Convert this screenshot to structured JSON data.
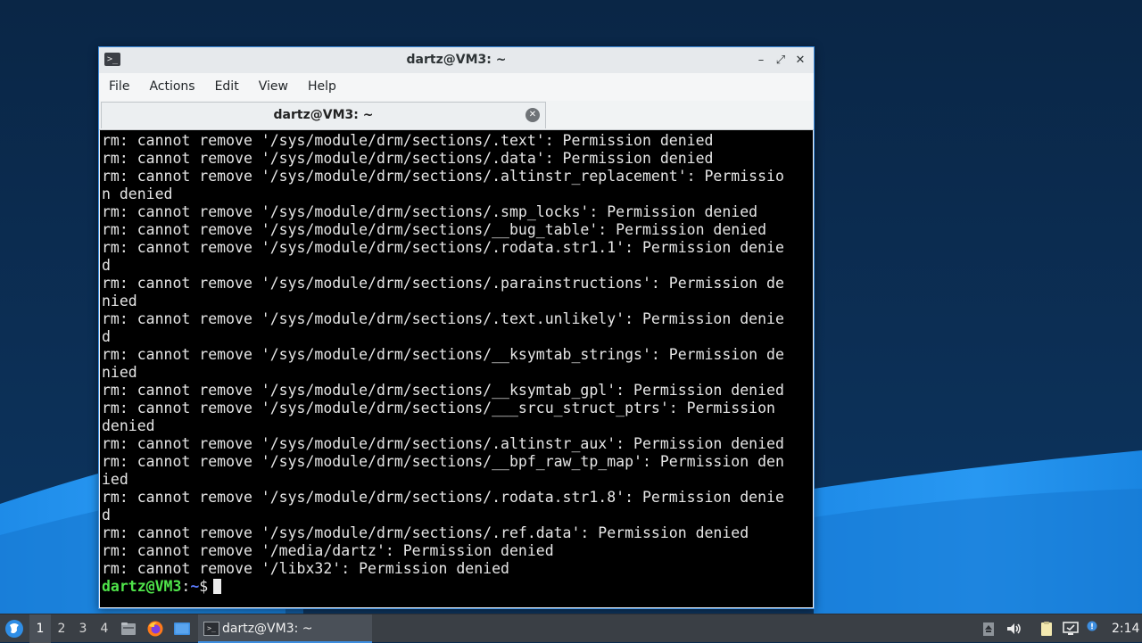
{
  "window": {
    "title": "dartz@VM3: ~",
    "app_icon": ">_",
    "controls": {
      "minimize": "–",
      "maximize": "⤢",
      "close": "✕"
    }
  },
  "menubar": {
    "items": [
      "File",
      "Actions",
      "Edit",
      "View",
      "Help"
    ]
  },
  "tab": {
    "label": "dartz@VM3: ~",
    "close_icon": "✕"
  },
  "terminal": {
    "lines": [
      "rm: cannot remove '/sys/module/drm/sections/.text': Permission denied",
      "rm: cannot remove '/sys/module/drm/sections/.data': Permission denied",
      "rm: cannot remove '/sys/module/drm/sections/.altinstr_replacement': Permissio",
      "n denied",
      "rm: cannot remove '/sys/module/drm/sections/.smp_locks': Permission denied",
      "rm: cannot remove '/sys/module/drm/sections/__bug_table': Permission denied",
      "rm: cannot remove '/sys/module/drm/sections/.rodata.str1.1': Permission denie",
      "d",
      "rm: cannot remove '/sys/module/drm/sections/.parainstructions': Permission de",
      "nied",
      "rm: cannot remove '/sys/module/drm/sections/.text.unlikely': Permission denie",
      "d",
      "rm: cannot remove '/sys/module/drm/sections/__ksymtab_strings': Permission de",
      "nied",
      "rm: cannot remove '/sys/module/drm/sections/__ksymtab_gpl': Permission denied",
      "rm: cannot remove '/sys/module/drm/sections/___srcu_struct_ptrs': Permission",
      "denied",
      "rm: cannot remove '/sys/module/drm/sections/.altinstr_aux': Permission denied",
      "rm: cannot remove '/sys/module/drm/sections/__bpf_raw_tp_map': Permission den",
      "ied",
      "rm: cannot remove '/sys/module/drm/sections/.rodata.str1.8': Permission denie",
      "d",
      "rm: cannot remove '/sys/module/drm/sections/.ref.data': Permission denied",
      "rm: cannot remove '/media/dartz': Permission denied",
      "rm: cannot remove '/libx32': Permission denied"
    ],
    "prompt": {
      "user_host": "dartz@VM3",
      "separator": ":",
      "path": "~",
      "symbol": "$"
    },
    "colors": {
      "background": "#000000",
      "text": "#e6e6e6",
      "prompt_user": "#4fe34a",
      "prompt_path": "#5c7cff"
    }
  },
  "taskbar": {
    "workspaces": [
      "1",
      "2",
      "3",
      "4"
    ],
    "active_workspace": "1",
    "launchers": [
      "file-manager-icon",
      "firefox-icon",
      "desktop-icon"
    ],
    "task": {
      "label": "dartz@VM3: ~",
      "icon": ">_"
    },
    "tray": [
      "trash-icon",
      "volume-icon",
      "clipboard-icon",
      "network-icon",
      "notification-icon"
    ],
    "clock": "2:14"
  },
  "colors": {
    "accent": "#3d8ee0",
    "taskbar": "#3a3f45",
    "desktop": "#0b2a4c"
  }
}
